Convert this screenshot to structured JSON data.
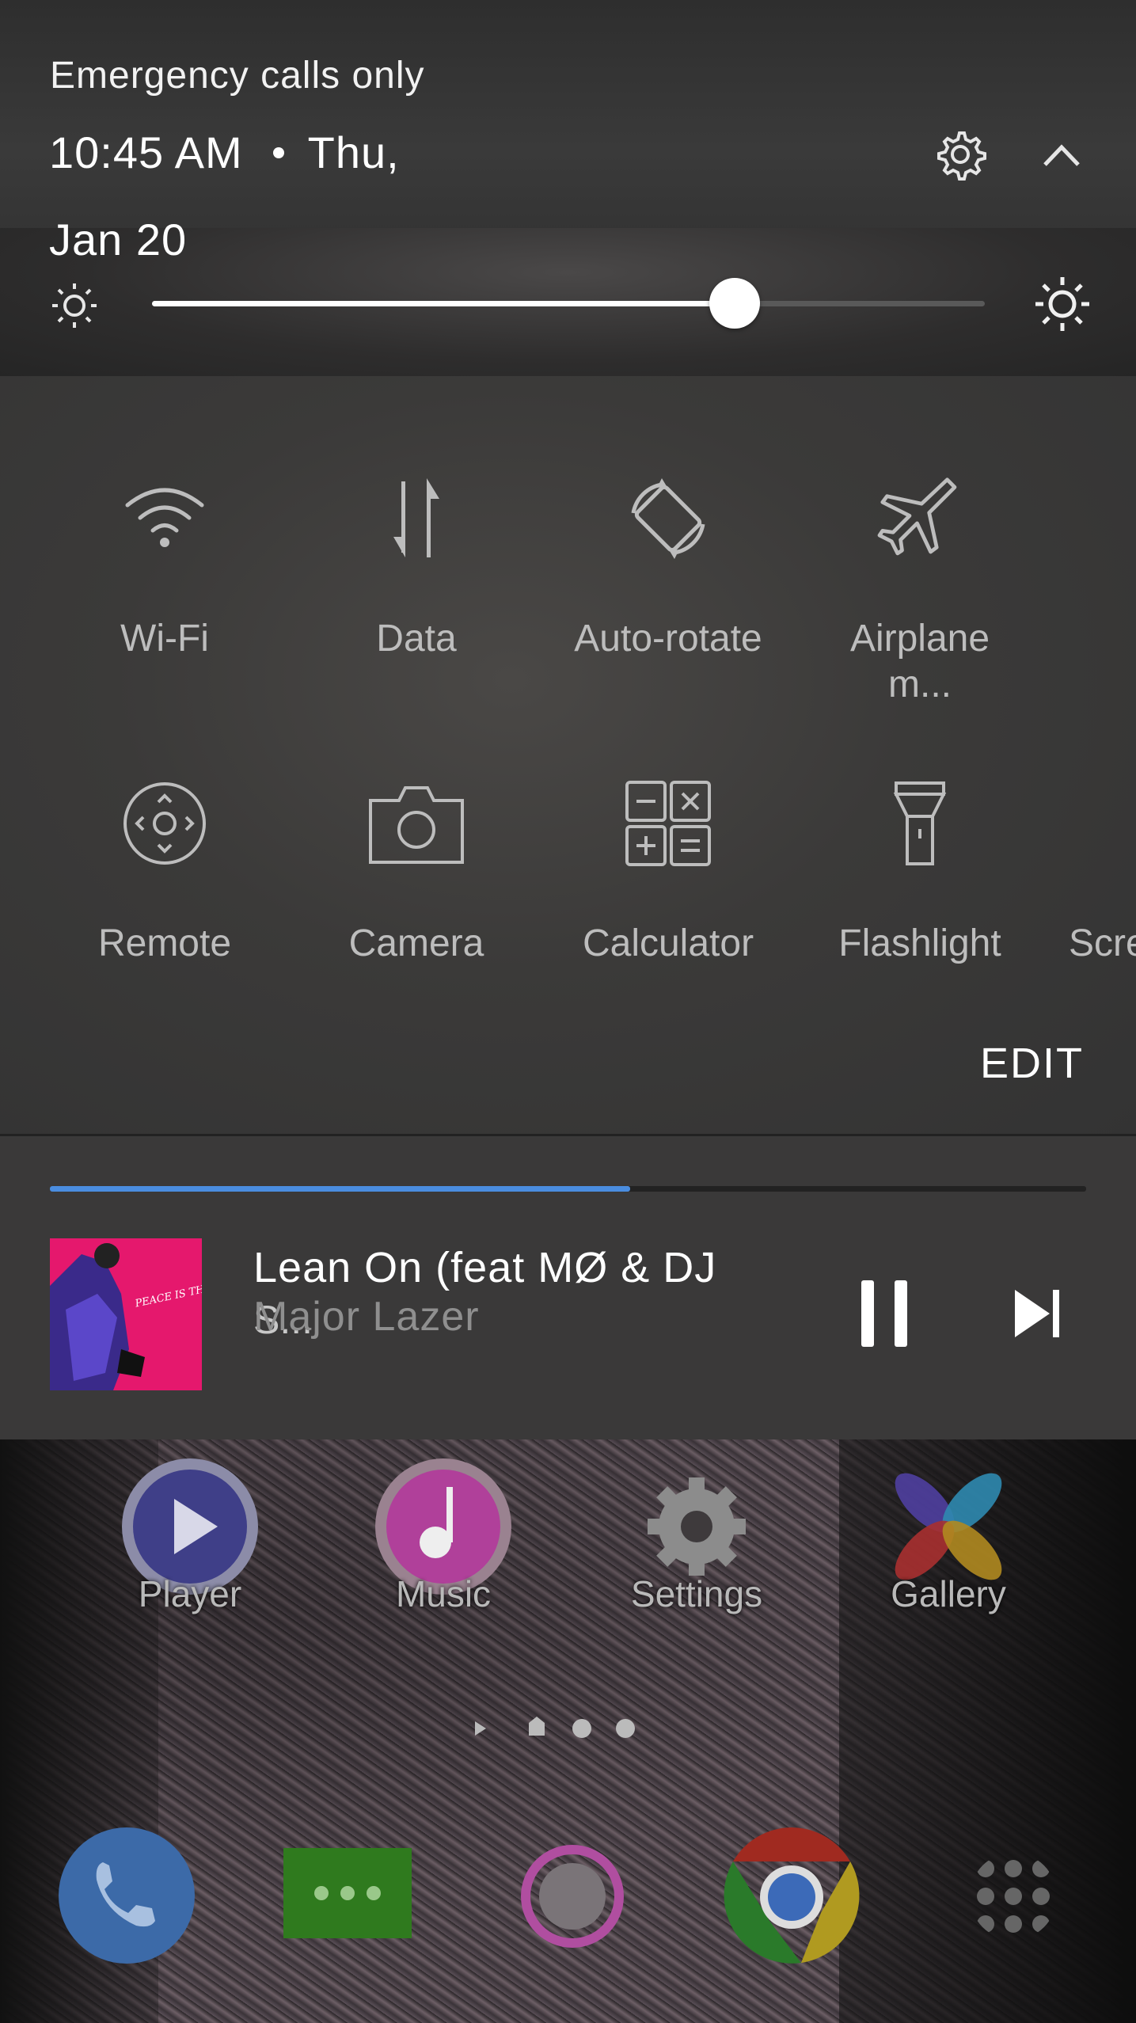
{
  "status": {
    "carrier": "Emergency calls only",
    "time": "10:45 AM",
    "day": "Thu,",
    "date": "Jan 20"
  },
  "brightness": {
    "level": 0.7
  },
  "tiles": [
    {
      "label": "Wi-Fi",
      "icon": "wifi-icon"
    },
    {
      "label": "Data",
      "icon": "data-arrows-icon"
    },
    {
      "label": "Auto-rotate",
      "icon": "auto-rotate-icon"
    },
    {
      "label": "Airplane\nm...",
      "line1": "Airplane",
      "line2": "m...",
      "icon": "airplane-icon"
    },
    {
      "label": "Remote",
      "icon": "remote-icon"
    },
    {
      "label": "Camera",
      "icon": "camera-icon"
    },
    {
      "label": "Calculator",
      "icon": "calculator-icon"
    },
    {
      "label": "Flashlight",
      "icon": "flashlight-icon"
    },
    {
      "label": "Scre",
      "icon": ""
    }
  ],
  "edit_label": "EDIT",
  "media": {
    "progress": 0.56,
    "title": "Lean On (feat MØ & DJ",
    "title_overflow": "S...",
    "artist": "Major Lazer",
    "album_art_text": "PEACE IS THE MISSION"
  },
  "home_apps": [
    {
      "label": "Player",
      "icon": "player-icon"
    },
    {
      "label": "Music",
      "icon": "music-icon"
    },
    {
      "label": "Settings",
      "icon": "settings-icon"
    },
    {
      "label": "Gallery",
      "icon": "gallery-icon"
    }
  ],
  "dock": [
    "phone-icon",
    "messages-icon",
    "camera-app-icon",
    "chrome-icon",
    "app-drawer-icon"
  ],
  "colors": {
    "accent": "#4a8de0",
    "album": "#e5186d"
  }
}
